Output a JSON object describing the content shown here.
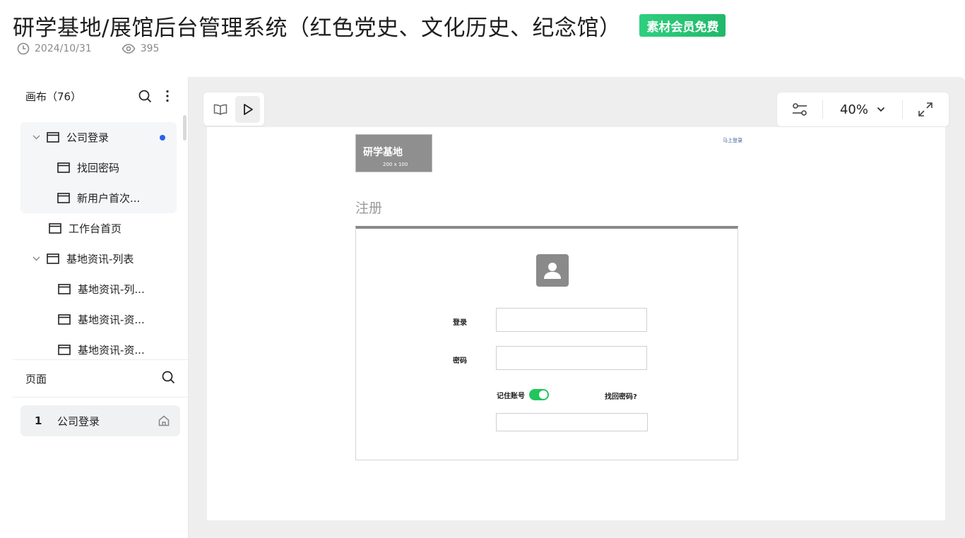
{
  "header": {
    "title": "研学基地/展馆后台管理系统（红色党史、文化历史、纪念馆）",
    "badge": "素材会员免费",
    "date": "2024/10/31",
    "views": "395"
  },
  "sidebar": {
    "canvas_label": "画布（76）",
    "tree": {
      "group": {
        "label": "公司登录",
        "children": [
          "找回密码",
          "新用户首次..."
        ]
      },
      "item_workbench": "工作台首页",
      "group2": {
        "label": "基地资讯-列表",
        "children": [
          "基地资讯-列...",
          "基地资讯-资...",
          "基地资讯-资..."
        ]
      }
    },
    "pages_label": "页面",
    "pages": [
      {
        "num": "1",
        "label": "公司登录"
      }
    ]
  },
  "toolbar": {
    "zoom": "40%"
  },
  "canvas": {
    "logo_title": "研学基地",
    "logo_size": "200 x 100",
    "top_link": "马上登录",
    "register_title": "注册",
    "login_label": "登录",
    "password_label": "密码",
    "remember_label": "记住账号",
    "forgot_label": "找回密码?",
    "login_value": "",
    "password_value": "",
    "bottom_value": ""
  },
  "colors": {
    "badge": "#2fcf7e",
    "active_dot": "#2563eb",
    "toggle_on": "#22c55e",
    "placeholder_gray": "#8f8f8f"
  }
}
